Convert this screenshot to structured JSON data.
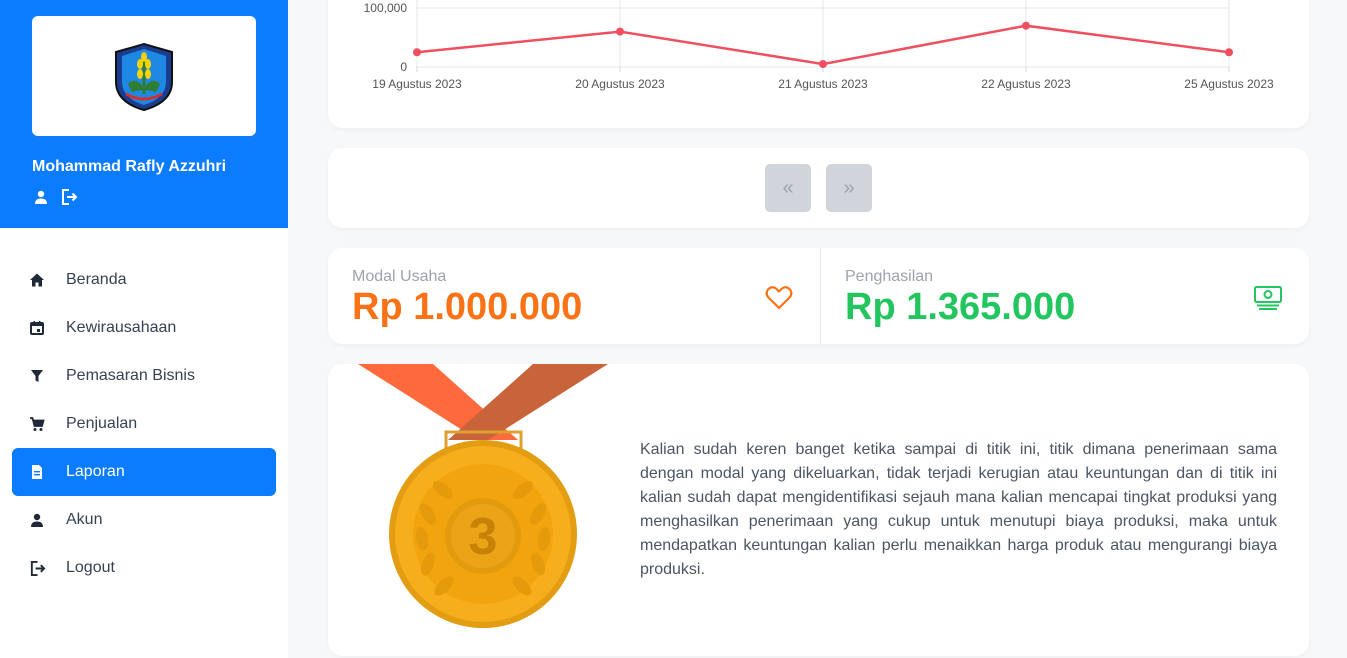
{
  "sidebar": {
    "user_name": "Mohammad Rafly Azzuhri",
    "user_icons": [
      "person-icon",
      "logout-icon"
    ],
    "items": [
      {
        "label": "Beranda",
        "icon": "home-icon"
      },
      {
        "label": "Kewirausahaan",
        "icon": "calendar-icon"
      },
      {
        "label": "Pemasaran Bisnis",
        "icon": "funnel-icon"
      },
      {
        "label": "Penjualan",
        "icon": "cart-icon"
      },
      {
        "label": "Laporan",
        "icon": "document-icon",
        "active": true
      },
      {
        "label": "Akun",
        "icon": "person-icon"
      },
      {
        "label": "Logout",
        "icon": "logout-icon"
      }
    ]
  },
  "chart_data": {
    "type": "line",
    "x": [
      "19 Agustus 2023",
      "20 Agustus 2023",
      "21 Agustus 2023",
      "22 Agustus 2023",
      "25 Agustus 2023"
    ],
    "series": [
      {
        "values": [
          25000,
          60000,
          5000,
          70000,
          25000
        ]
      }
    ],
    "ytick_labels": [
      "0",
      "100,000"
    ],
    "line_color": "#ef4f5f",
    "grid": true
  },
  "pager": {
    "prev_label": "«",
    "next_label": "»"
  },
  "stats": {
    "modal": {
      "label": "Modal Usaha",
      "value": "Rp 1.000.000",
      "color": "#f97316",
      "icon": "heart-icon"
    },
    "income": {
      "label": "Penghasilan",
      "value": "Rp 1.365.000",
      "color": "#22c55e",
      "icon": "money-icon"
    }
  },
  "medal": {
    "rank": "3",
    "text": "Kalian sudah keren banget ketika sampai di titik ini, titik dimana penerimaan sama dengan modal yang dikeluarkan, tidak terjadi kerugian atau keuntungan dan di titik ini kalian sudah dapat mengidentifikasi sejauh mana kalian mencapai tingkat produksi yang menghasilkan penerimaan yang cukup untuk menutupi biaya produksi, maka untuk mendapatkan keuntungan kalian perlu menaikkan harga produk atau mengurangi biaya produksi."
  },
  "colors": {
    "primary": "#0b7bff",
    "sidebar_bg": "#ffffff",
    "page_bg": "#f7f8fa"
  }
}
